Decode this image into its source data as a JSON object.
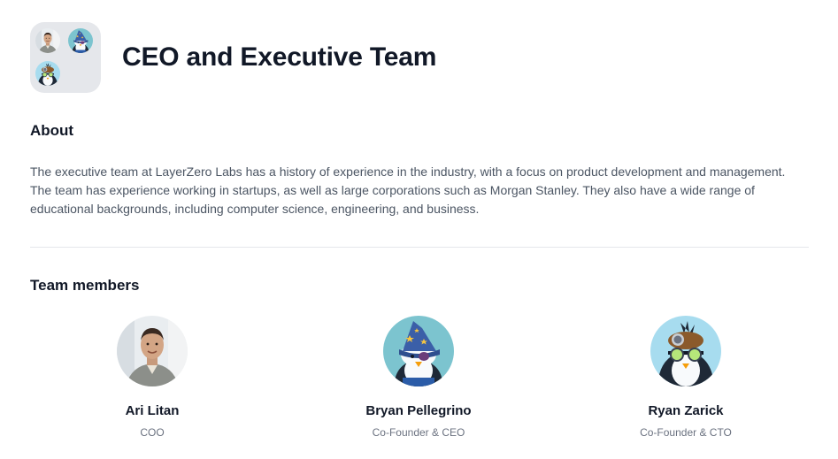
{
  "header": {
    "title": "CEO and Executive Team",
    "icon": "group-avatars-icon"
  },
  "about": {
    "heading": "About",
    "text": "The executive team at LayerZero Labs has a history of experience in the industry, with a focus on product development and management. The team has experience working in startups, as well as large corporations such as Morgan Stanley. They also have a wide range of educational backgrounds, including computer science, engineering, and business."
  },
  "team": {
    "heading": "Team members",
    "members": [
      {
        "name": "Ari Litan",
        "role": "COO",
        "avatar": "photo-avatar"
      },
      {
        "name": "Bryan Pellegrino",
        "role": "Co-Founder & CEO",
        "avatar": "wizard-penguin-avatar"
      },
      {
        "name": "Ryan Zarick",
        "role": "Co-Founder & CTO",
        "avatar": "goggles-penguin-avatar"
      }
    ]
  },
  "colors": {
    "text": "#111827",
    "muted": "#4b5563",
    "divider": "#e5e7eb",
    "icon_bg": "#e5e7eb",
    "wizard_bg": "#7cc4cf",
    "goggles_bg": "#a7dcef"
  }
}
